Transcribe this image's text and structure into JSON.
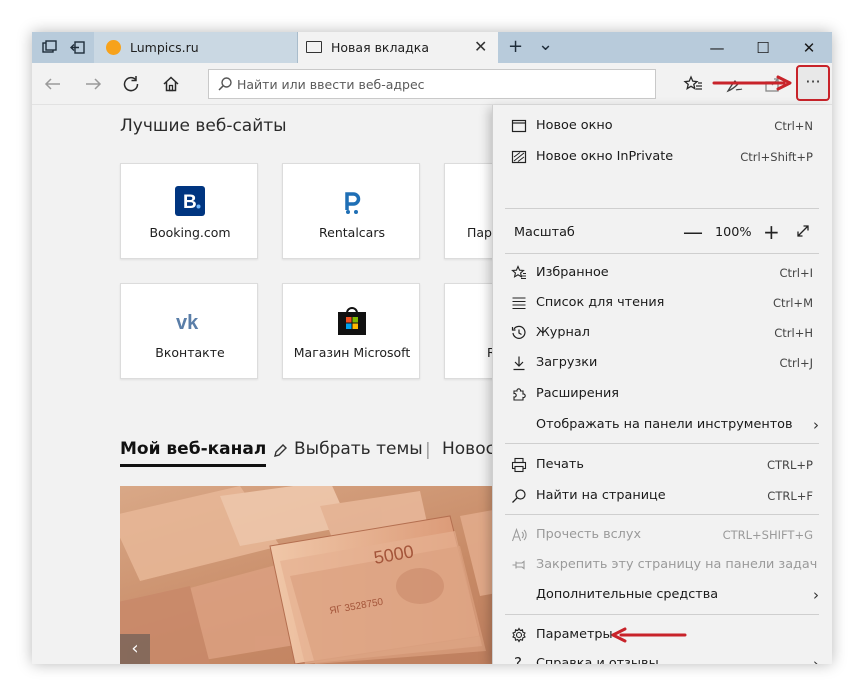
{
  "tabs": {
    "inactive": {
      "label": "Lumpics.ru"
    },
    "active": {
      "label": "Новая вкладка"
    }
  },
  "tab_controls": {
    "close": "✕",
    "new_tab": "+",
    "list": "⌄"
  },
  "window_controls": {
    "minimize": "—",
    "maximize": "☐",
    "close": "✕"
  },
  "address_bar": {
    "placeholder": "Найти или ввести веб-адрес"
  },
  "more_button": {
    "label": "···"
  },
  "top_sites": {
    "title": "Лучшие веб-сайты",
    "tiles": [
      {
        "name": "Booking.com",
        "logo": "booking-logo"
      },
      {
        "name": "Rentalcars",
        "logo": "rentalcars-logo"
      },
      {
        "name": "Пар",
        "logo": ""
      },
      {
        "name": "Вконтакте",
        "logo": "vk-logo"
      },
      {
        "name": "Магазин Microsoft",
        "logo": "microsoft-store-logo"
      },
      {
        "name": "R",
        "logo": ""
      }
    ]
  },
  "feed": {
    "active_tab": "Мой веб-канал",
    "choose_topics": "Выбрать темы",
    "separator": "|",
    "news": "Новос",
    "prev_arrow": "‹"
  },
  "menu": {
    "items_top": [
      {
        "label": "Новое окно",
        "shortcut": "Ctrl+N",
        "icon": "window-icon"
      },
      {
        "label": "Новое окно InPrivate",
        "shortcut": "Ctrl+Shift+P",
        "icon": "inprivate-icon"
      }
    ],
    "zoom": {
      "label": "Масштаб",
      "value": "100%",
      "minus": "—",
      "plus": "+"
    },
    "items_mid": [
      {
        "label": "Избранное",
        "shortcut": "Ctrl+I",
        "icon": "favorites-icon"
      },
      {
        "label": "Список для чтения",
        "shortcut": "Ctrl+M",
        "icon": "reading-list-icon"
      },
      {
        "label": "Журнал",
        "shortcut": "Ctrl+H",
        "icon": "history-icon"
      },
      {
        "label": "Загрузки",
        "shortcut": "Ctrl+J",
        "icon": "downloads-icon"
      },
      {
        "label": "Расширения",
        "shortcut": "",
        "icon": "extensions-icon"
      },
      {
        "label": "Отображать на панели инструментов",
        "shortcut": "",
        "icon": ""
      }
    ],
    "items_tools": [
      {
        "label": "Печать",
        "shortcut": "CTRL+P",
        "icon": "print-icon"
      },
      {
        "label": "Найти на странице",
        "shortcut": "CTRL+F",
        "icon": "find-icon"
      }
    ],
    "items_disabled": [
      {
        "label": "Прочесть вслух",
        "shortcut": "CTRL+SHIFT+G",
        "icon": "read-aloud-icon"
      },
      {
        "label": "Закрепить эту страницу на панели задач",
        "shortcut": "",
        "icon": "pin-icon"
      },
      {
        "label": "Дополнительные средства",
        "shortcut": "",
        "icon": ""
      }
    ],
    "items_bottom": [
      {
        "label": "Параметры",
        "shortcut": "",
        "icon": "settings-icon"
      },
      {
        "label": "Справка и отзывы",
        "shortcut": "",
        "icon": "help-icon"
      }
    ],
    "chevron": "›"
  },
  "colors": {
    "tab_bar": "#b8cbdb",
    "annotation": "#c8232a",
    "booking": "#003580",
    "rentalcars": "#1f6fb5",
    "vk": "#5a7ea8"
  }
}
